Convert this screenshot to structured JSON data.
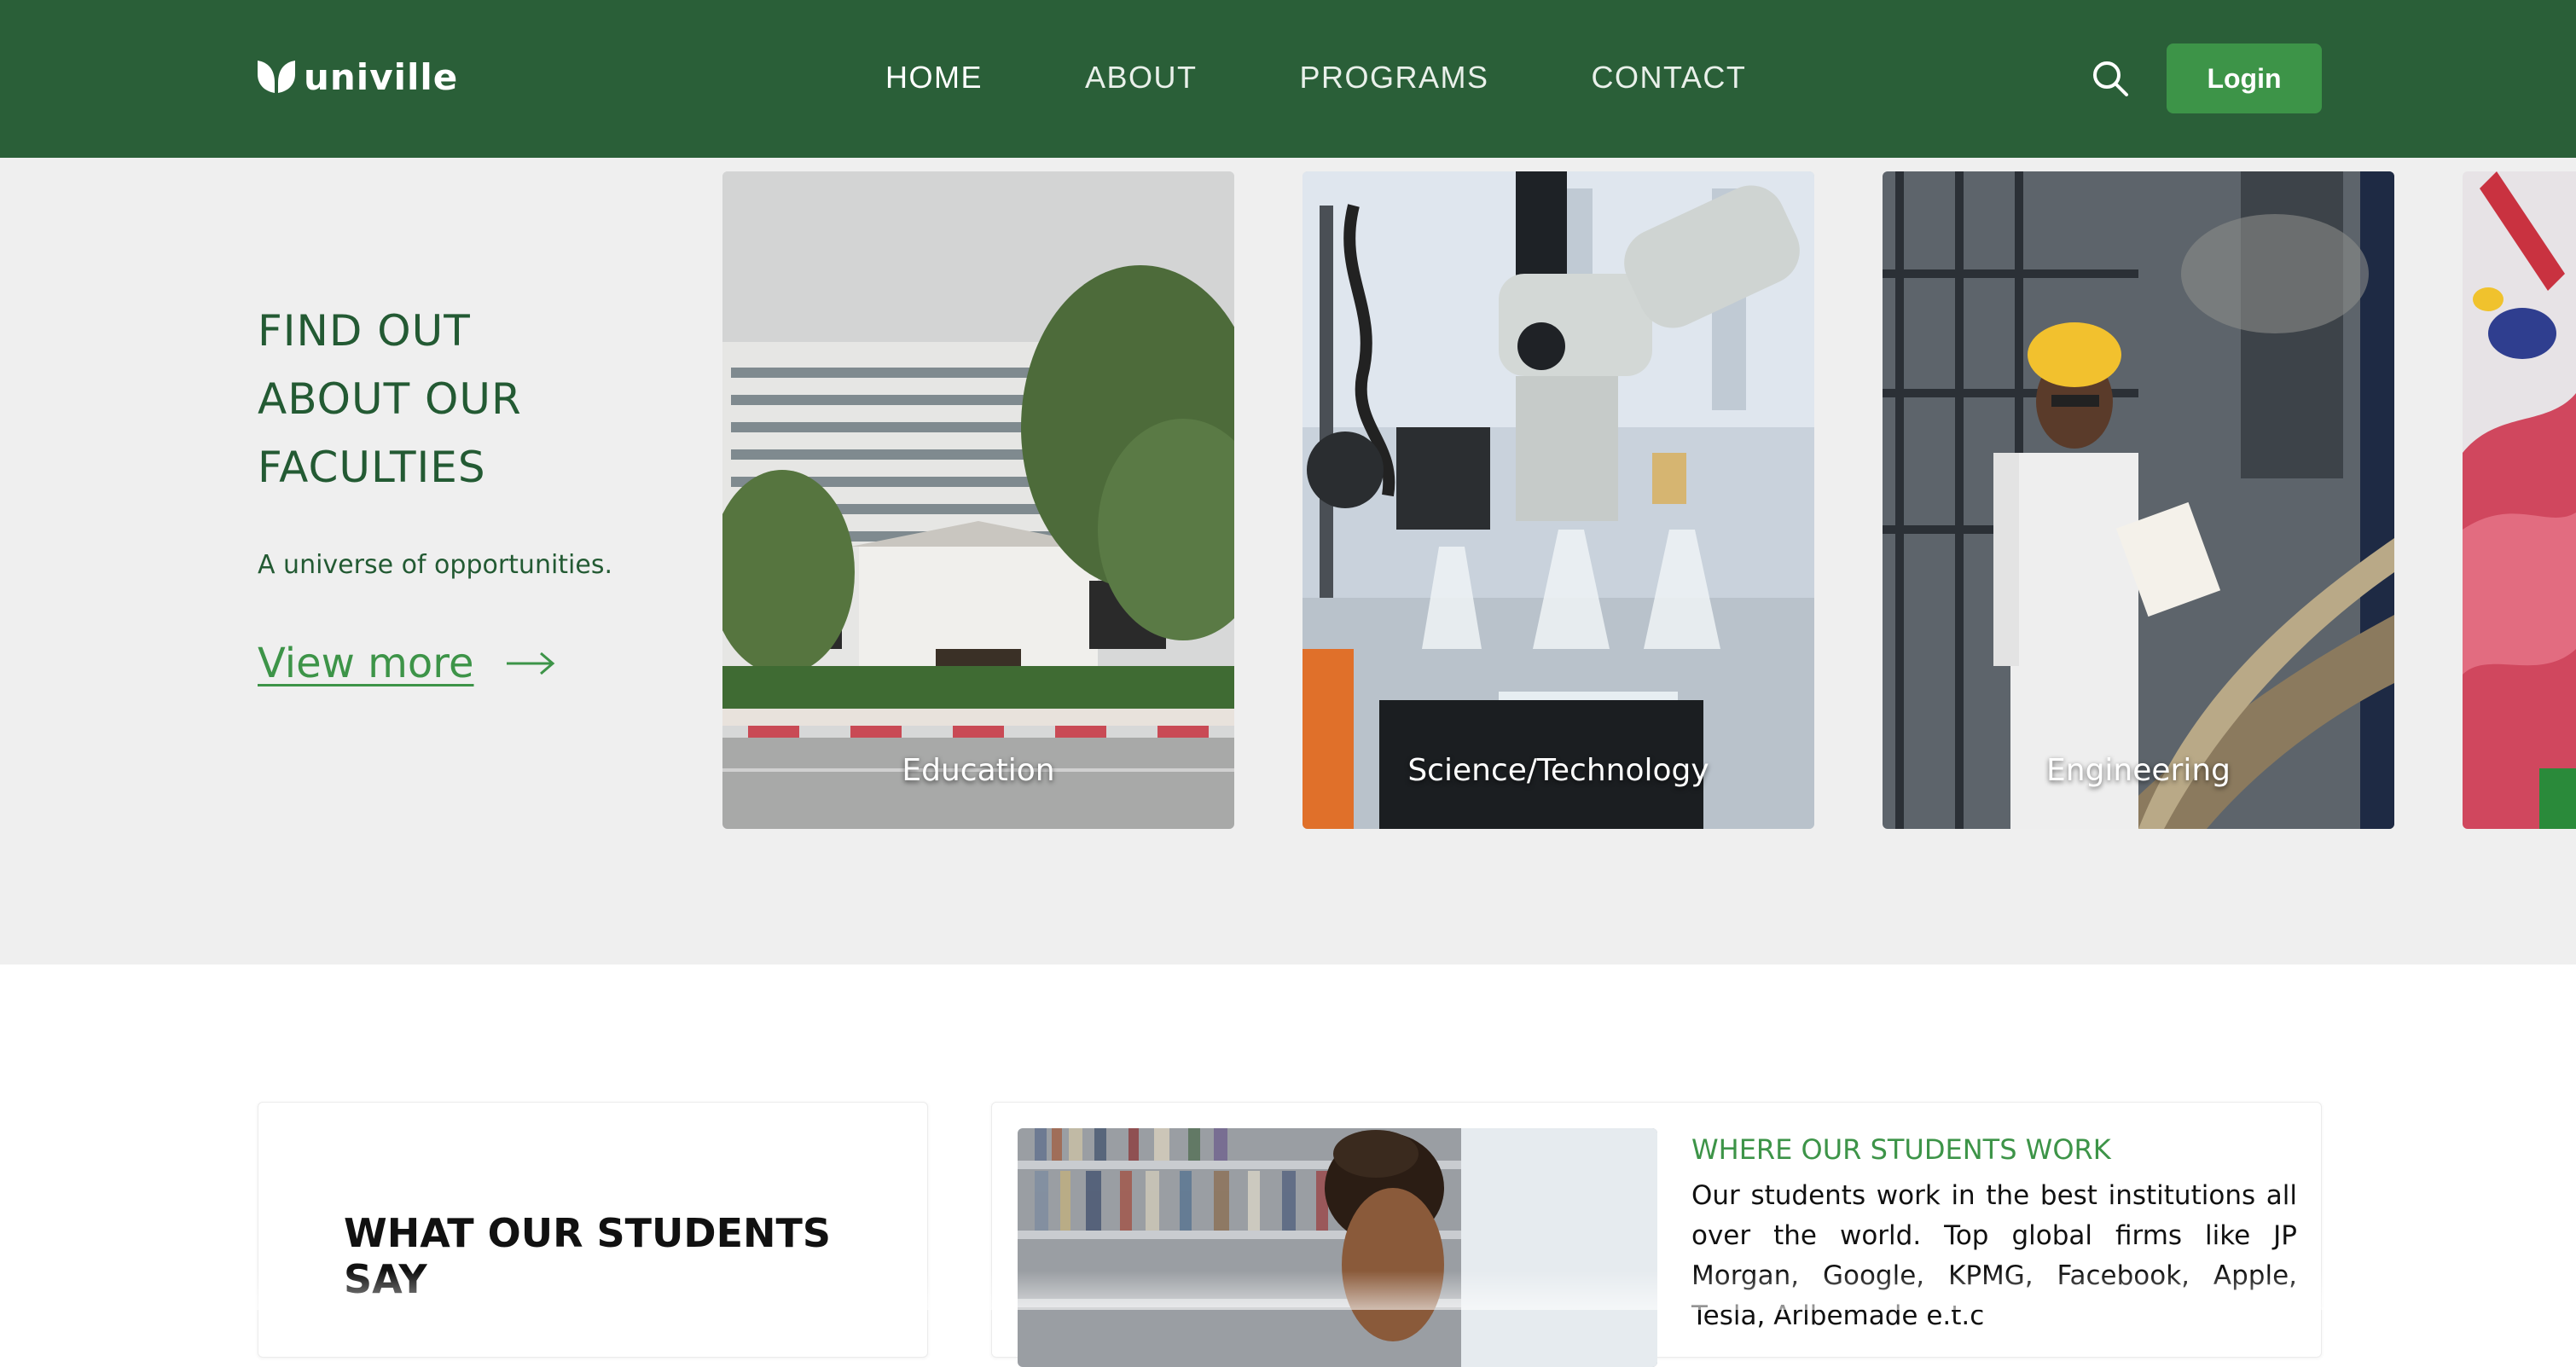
{
  "brand": {
    "name": "univille",
    "primary": "#2a5f38",
    "accent": "#3d9448",
    "band_bg": "#efefef"
  },
  "nav": {
    "items": [
      {
        "label": "HOME",
        "active": true
      },
      {
        "label": "ABOUT",
        "active": false
      },
      {
        "label": "PROGRAMS",
        "active": false
      },
      {
        "label": "CONTACT",
        "active": false
      }
    ],
    "search_icon": "search-icon",
    "login_label": "Login"
  },
  "faculties": {
    "title_lines": [
      "FIND OUT",
      "ABOUT OUR",
      "FACULTIES"
    ],
    "subtitle": "A universe of opportunities.",
    "view_more": "View more",
    "cards": [
      {
        "label": "Education"
      },
      {
        "label": "Science/Technology"
      },
      {
        "label": "Engineering"
      },
      {
        "label": ""
      }
    ]
  },
  "students_say": {
    "title": "WHAT OUR STUDENTS SAY"
  },
  "students_work": {
    "title": "WHERE OUR STUDENTS WORK",
    "text": "Our students work in the best institutions all over the world. Top global firms like JP Morgan, Google, KPMG, Facebook, Apple, Tesla, Arlbemade e.t.c"
  }
}
